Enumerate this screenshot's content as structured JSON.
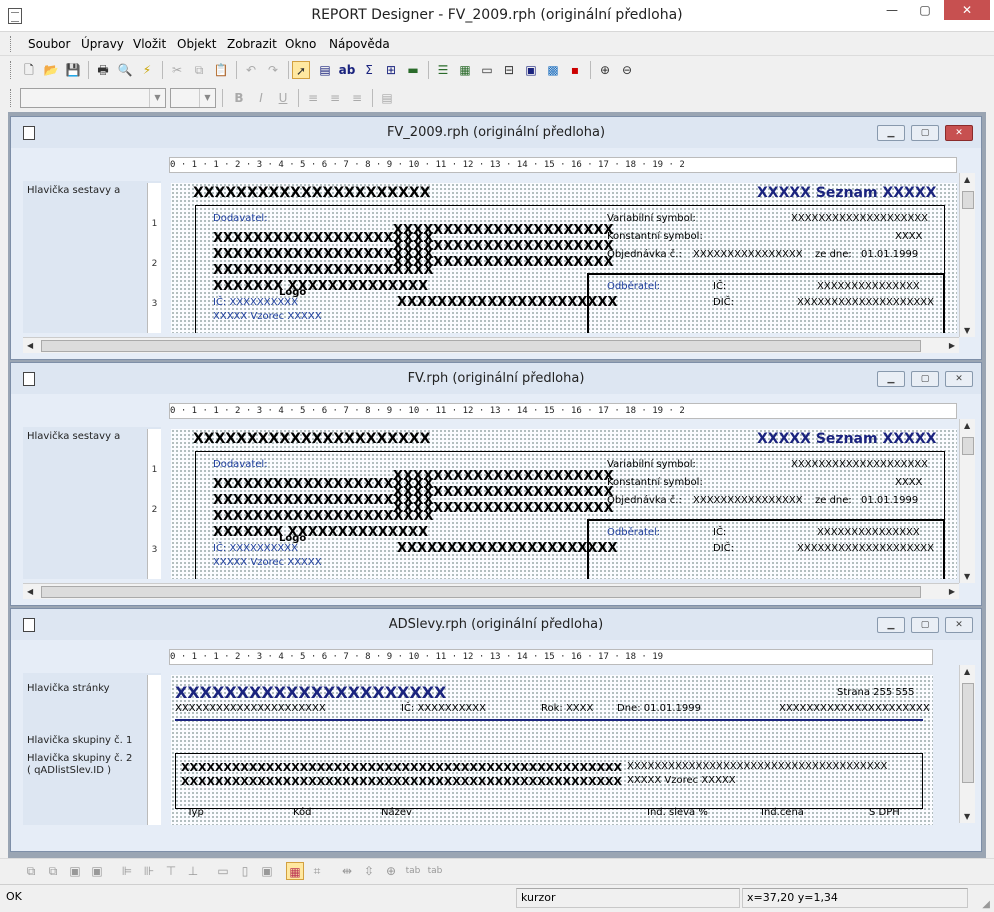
{
  "app": {
    "title": "REPORT Designer - FV_2009.rph (originální předloha)",
    "window_buttons": [
      "—",
      "▢",
      "✕"
    ]
  },
  "menu": [
    "Soubor",
    "Úpravy",
    "Vložit",
    "Objekt",
    "Zobrazit",
    "Okno",
    "Nápověda"
  ],
  "toolbar1": {
    "icons": [
      "new-icon",
      "open-icon",
      "save-icon",
      "print-icon",
      "print-preview-icon",
      "run-icon",
      "cut-icon",
      "copy-icon",
      "paste-icon",
      "undo-icon",
      "redo-icon",
      "pointer-icon",
      "field-icon",
      "text-icon",
      "sum-icon",
      "expression-icon",
      "line-icon",
      "band-icon",
      "group-icon",
      "page-header-icon",
      "page-footer-icon",
      "image-icon",
      "chart-icon",
      "picture-icon",
      "zoom-in-icon",
      "zoom-out-icon"
    ]
  },
  "toolbar2": {
    "font_value": "",
    "size_value": "",
    "bold": "B",
    "italic": "I",
    "underline": "U"
  },
  "windows": [
    {
      "title": "FV_2009.rph (originální předloha)",
      "ruler": "0 · 1 · 1 · 2 · 3 · 4 · 5 · 6 · 7 · 8 · 9 · 10 · 11 · 12 · 13 · 14 · 15 · 16 · 17 · 18 · 19 · 2",
      "section_label": "Hlavička sestavy a",
      "vruler": [
        "1",
        "2",
        "3"
      ],
      "header_x": "XXXXXXXXXXXXXXXXXXXXXX",
      "header_right": "XXXXX Seznam XXXXX",
      "dodavatel": "Dodavatel:",
      "rows_x": [
        "XXXXXXXXXXXXXXXXXXXXXX",
        "XXXXXXXXXXXXXXXXXXXXXX",
        "XXXXXXXXXXXXXXXXXXXXXX",
        "XXXXXXX XXXXXXXXXXXXXX"
      ],
      "logo": "Logo",
      "ic": "IČ: XXXXXXXXXX",
      "vzorec": "XXXXX Vzorec XXXXX",
      "variabilni": "Variabilní symbol:",
      "konstantni": "Konstantní symbol:",
      "objednavka": "Objednávka č.:",
      "objednavka_val": "XXXXXXXXXXXXXXXX",
      "ze_dne": "ze dne:",
      "date": "01.01.1999",
      "vs_val": "XXXXXXXXXXXXXXXXXXXX",
      "ks_val": "XXXX",
      "odberatel": "Odběratel:",
      "ic_label": "IČ:",
      "dic_label": "DIČ:",
      "ic_val": "XXXXXXXXXXXXXXX",
      "dic_val": "XXXXXXXXXXXXXXXXXXXX",
      "active": true
    },
    {
      "title": "FV.rph (originální předloha)",
      "ruler": "0 · 1 · 1 · 2 · 3 · 4 · 5 · 6 · 7 · 8 · 9 · 10 · 11 · 12 · 13 · 14 · 15 · 16 · 17 · 18 · 19 · 2",
      "section_label": "Hlavička sestavy a",
      "vruler": [
        "1",
        "2",
        "3"
      ],
      "header_x": "XXXXXXXXXXXXXXXXXXXXXX",
      "header_right": "XXXXX Seznam XXXXX",
      "dodavatel": "Dodavatel:",
      "rows_x": [
        "XXXXXXXXXXXXXXXXXXXXXX",
        "XXXXXXXXXXXXXXXXXXXXXX",
        "XXXXXXXXXXXXXXXXXXXXXX",
        "XXXXXXX XXXXXXXXXXXXXX"
      ],
      "logo": "Logo",
      "ic": "IČ: XXXXXXXXXX",
      "vzorec": "XXXXX Vzorec XXXXX",
      "variabilni": "Variabilní symbol:",
      "konstantni": "Konstantní symbol:",
      "objednavka": "Objednávka č.:",
      "objednavka_val": "XXXXXXXXXXXXXXXX",
      "ze_dne": "ze dne:",
      "date": "01.01.1999",
      "vs_val": "XXXXXXXXXXXXXXXXXXXX",
      "ks_val": "XXXX",
      "odberatel": "Odběratel:",
      "ic_label": "IČ:",
      "dic_label": "DIČ:",
      "ic_val": "XXXXXXXXXXXXXXX",
      "dic_val": "XXXXXXXXXXXXXXXXXXXX",
      "active": false
    }
  ],
  "ads": {
    "title": "ADSlevy.rph (originální předloha)",
    "ruler": "0 · 1 · 1 · 2 · 3 · 4 · 5 · 6 · 7 · 8 · 9 · 10 · 11 · 12 · 13 · 14 · 15 · 16 · 17 · 18 · 19",
    "labels": [
      "Hlavička stránky",
      "Hlavička skupiny č. 1",
      "Hlavička skupiny č. 2",
      "( qADlistSlev.ID )"
    ],
    "big_x": "XXXXXXXXXXXXXXXXXXXXXX",
    "strana": "Strana 255 555",
    "row_x": "XXXXXXXXXXXXXXXXXXXXXX",
    "ic": "IČ: XXXXXXXXXX",
    "rok": "Rok: XXXX",
    "dne": "Dne: 01.01.1999",
    "right_x": "XXXXXXXXXXXXXXXXXXXXXX",
    "group_x1": "XXXXXXXXXXXXXXXXXXXXXXXXXXXXXXXXXXXXXXXXXXXXXXXXXXXX",
    "group_x2": "XXXXXXXXXXXXXXXXXXXXXXXXXXXXXXXXXXXXXXXXXXXXXXXXXXXX",
    "group_right1": "XXXXXXXXXXXXXXXXXXXXXXXXXXXXXXXXXXXXXX",
    "group_right2": "XXXXX Vzorec XXXXX",
    "cols": [
      "Typ",
      "Kód",
      "Název",
      "Ind. sleva %",
      "Ind.cena",
      "S DPH"
    ]
  },
  "status": {
    "left": "OK",
    "mode": "kurzor",
    "coords": "x=37,20  y=1,34"
  }
}
